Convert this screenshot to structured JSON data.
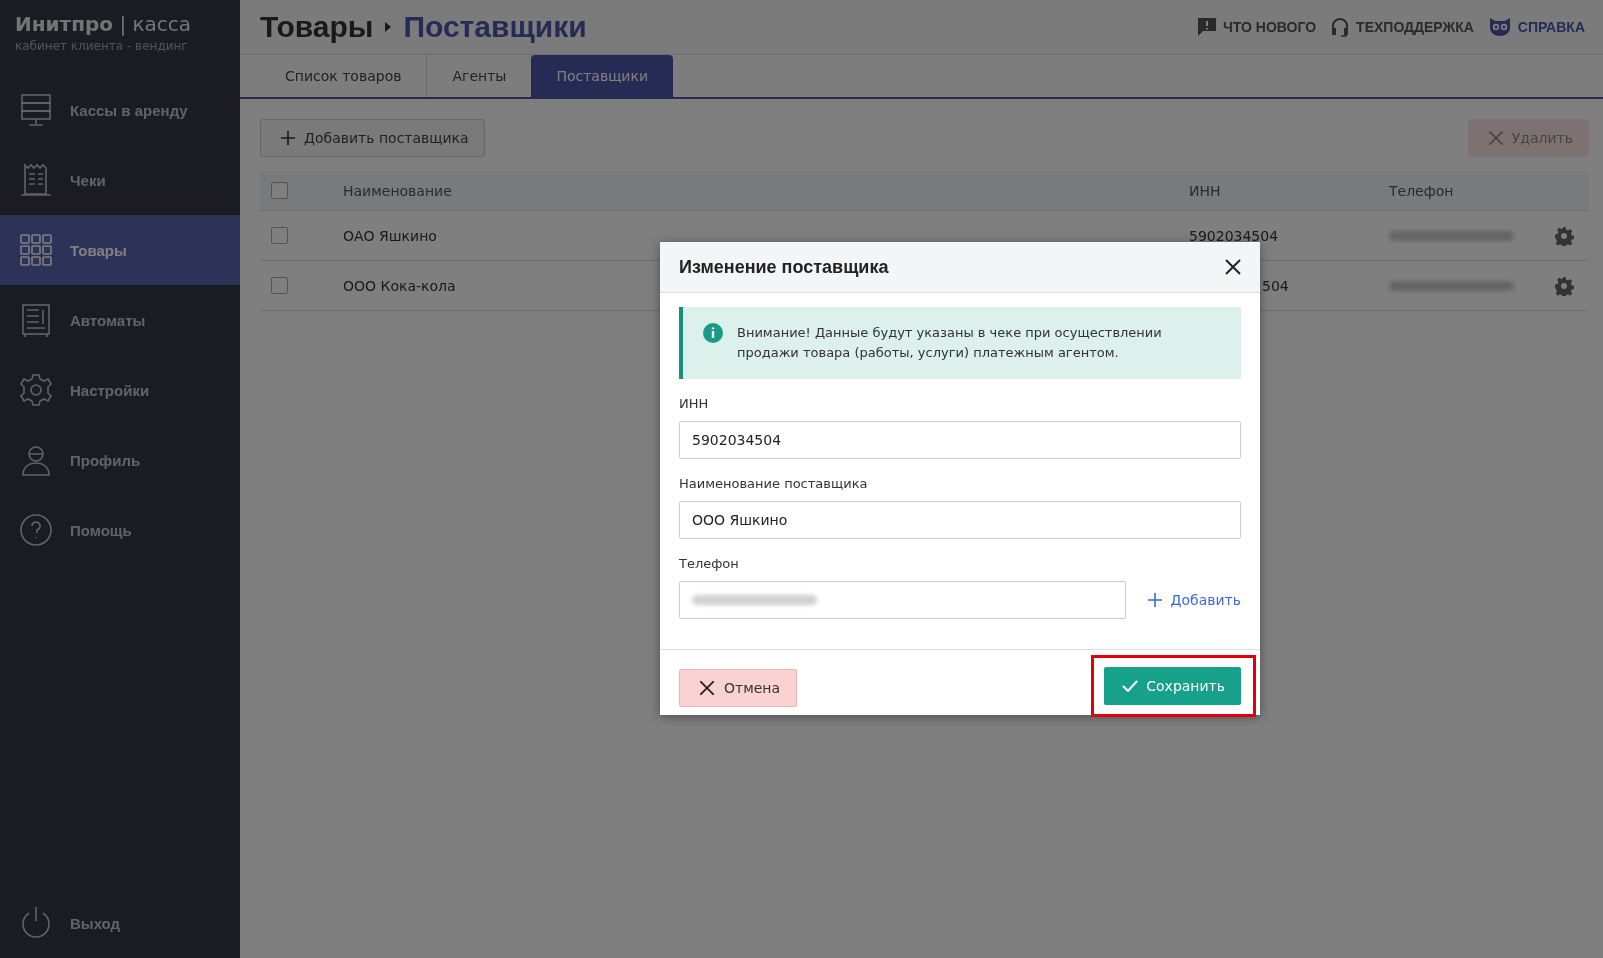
{
  "brand": {
    "name": "Инитпро",
    "product": "касса",
    "separator": "|",
    "subtitle": "кабинет клиента - вендинг"
  },
  "sidebar": {
    "items": [
      {
        "label": "Кассы в аренду",
        "selected": false
      },
      {
        "label": "Чеки",
        "selected": false
      },
      {
        "label": "Товары",
        "selected": true
      },
      {
        "label": "Автоматы",
        "selected": false
      },
      {
        "label": "Настройки",
        "selected": false
      },
      {
        "label": "Профиль",
        "selected": false
      },
      {
        "label": "Помощь",
        "selected": false
      }
    ],
    "logout": "Выход"
  },
  "breadcrumb": [
    "Товары",
    "Поставщики"
  ],
  "header_links": [
    {
      "label": "ЧТО НОВОГО",
      "selected": false
    },
    {
      "label": "ТЕХПОДДЕРЖКА",
      "selected": false
    },
    {
      "label": "СПРАВКА",
      "selected": true
    }
  ],
  "tabs": [
    {
      "label": "Список товаров",
      "selected": false
    },
    {
      "label": "Агенты",
      "selected": false
    },
    {
      "label": "Поставщики",
      "selected": true
    }
  ],
  "toolbar": {
    "add": "Добавить поставщика",
    "delete": "Удалить",
    "delete_disabled": true
  },
  "table": {
    "columns": [
      "Наименование",
      "ИНН",
      "Телефон"
    ],
    "header_checked": false,
    "rows": [
      {
        "checked": false,
        "name": "ОАО Яшкино",
        "inn": "5902034504",
        "covered": false
      },
      {
        "checked": false,
        "name": "ООО Кока-кола",
        "inn": "504",
        "covered": true
      }
    ]
  },
  "dialog": {
    "title": "Изменение поставщика",
    "notice": "Внимание! Данные будут указаны в чеке при осуществлении продажи товара (работы, услуги) платежным агентом.",
    "fields": [
      {
        "label": "ИНН",
        "value": "5902034504",
        "kind": "text"
      },
      {
        "label": "Наименование поставщика",
        "value": "ООО Яшкино",
        "kind": "text"
      },
      {
        "label": "Телефон",
        "kind": "phone",
        "add": "Добавить"
      }
    ],
    "cancel": "Отмена",
    "save": "Сохранить",
    "save_highlighted": true
  }
}
